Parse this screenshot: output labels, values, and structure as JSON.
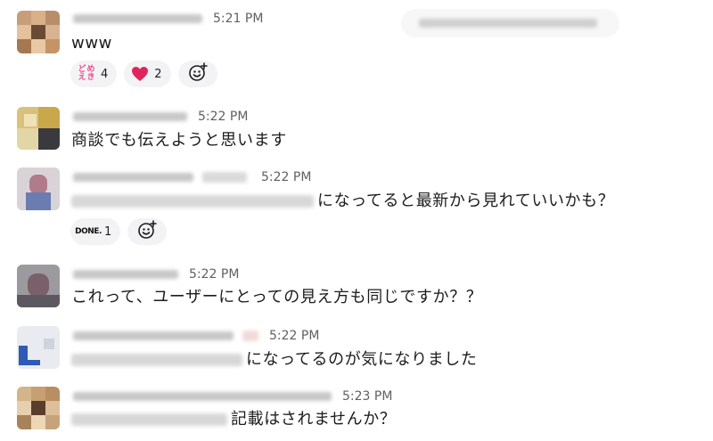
{
  "channel_header": {
    "label": ""
  },
  "messages": [
    {
      "time": "5:21 PM",
      "text": "www",
      "reactions": [
        {
          "emoji": "domeiki-icon",
          "count": "4"
        },
        {
          "emoji": "heart-icon",
          "count": "2"
        }
      ]
    },
    {
      "time": "5:22 PM",
      "text": "商談でも伝えようと思います"
    },
    {
      "time": "5:22 PM",
      "text": "になってると最新から見れていいかも？",
      "reactions": [
        {
          "emoji": "done-icon",
          "count": "1"
        }
      ]
    },
    {
      "time": "5:22 PM",
      "text": "これって、ユーザーにとっての見え方も同じですか？？"
    },
    {
      "time": "5:22 PM",
      "text": "になってるのが気になりました"
    },
    {
      "time": "5:23 PM",
      "text": "記載はされませんか？"
    }
  ],
  "emoji_text": {
    "domeiki": [
      "ど",
      "め",
      "え",
      "き"
    ],
    "done": "DONE."
  },
  "colors": {
    "text": "#1d1c1d",
    "timestamp": "#616061",
    "reaction_bg": "#f3f3f5",
    "heart": "#e0245e",
    "domeiki": "#ec4f8f"
  }
}
